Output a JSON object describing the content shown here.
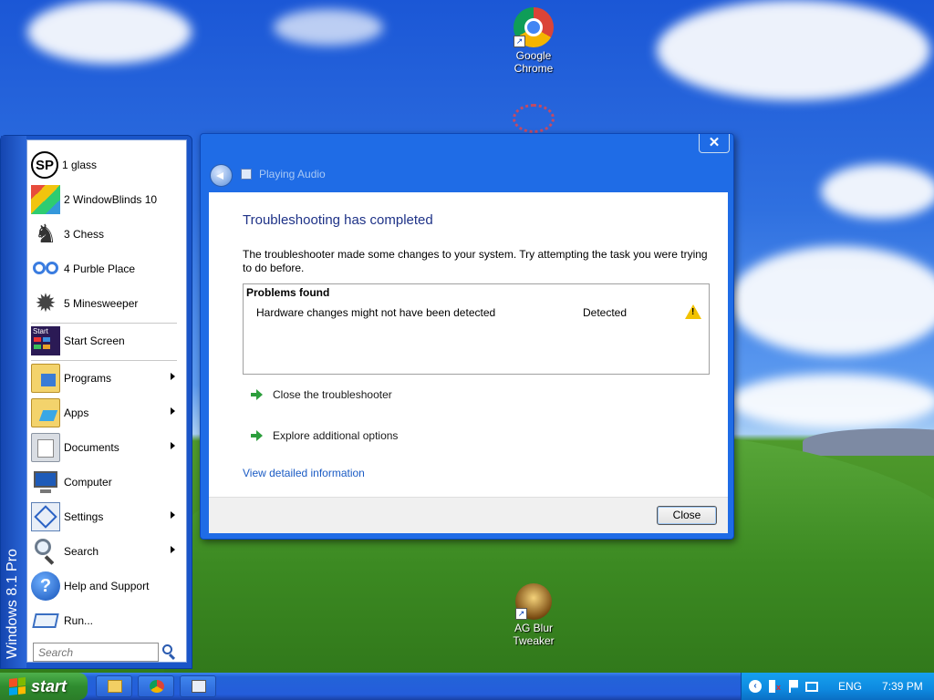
{
  "desktop": {
    "icons": [
      {
        "label": "Google Chrome",
        "icon": "chrome-icon"
      },
      {
        "label": "AG Blur Tweaker",
        "icon": "ag-blur-tweaker-icon"
      }
    ]
  },
  "start_menu": {
    "side_text": "Windows 8.1 Pro",
    "pinned": [
      {
        "label": "1 glass",
        "icon": "sp-icon"
      },
      {
        "label": "2 WindowBlinds 10",
        "icon": "windowblinds-icon"
      },
      {
        "label": "3 Chess",
        "icon": "chess-icon"
      },
      {
        "label": "4 Purble Place",
        "icon": "purble-place-icon"
      },
      {
        "label": "5 Minesweeper",
        "icon": "minesweeper-icon"
      }
    ],
    "start_screen": {
      "label": "Start Screen",
      "badge": "Start",
      "icon": "start-screen-icon"
    },
    "items": [
      {
        "label": "Programs",
        "icon": "programs-icon",
        "submenu": true
      },
      {
        "label": "Apps",
        "icon": "apps-icon",
        "submenu": true
      },
      {
        "label": "Documents",
        "icon": "documents-icon",
        "submenu": true
      },
      {
        "label": "Computer",
        "icon": "computer-icon",
        "submenu": false
      },
      {
        "label": "Settings",
        "icon": "settings-icon",
        "submenu": true
      },
      {
        "label": "Search",
        "icon": "search-icon",
        "submenu": true
      },
      {
        "label": "Help and Support",
        "icon": "help-icon",
        "submenu": false
      },
      {
        "label": "Run...",
        "icon": "run-icon",
        "submenu": false
      }
    ],
    "search_placeholder": "Search"
  },
  "dialog": {
    "title": "Playing Audio",
    "close_glyph": "✕",
    "heading": "Troubleshooting has completed",
    "description": "The troubleshooter made some changes to your system. Try attempting the task you were trying to do before.",
    "problems_header": "Problems found",
    "problems": [
      {
        "text": "Hardware changes might not have been detected",
        "status": "Detected",
        "icon": "warning-icon"
      }
    ],
    "actions": [
      {
        "label": "Close the troubleshooter"
      },
      {
        "label": "Explore additional options"
      }
    ],
    "details_link": "View detailed information",
    "close_button": "Close"
  },
  "taskbar": {
    "start_label": "start",
    "buttons": [
      {
        "icon": "file-explorer-icon"
      },
      {
        "icon": "chrome-icon"
      },
      {
        "icon": "troubleshooter-window-icon"
      }
    ],
    "tray": {
      "language": "ENG",
      "time": "7:39 PM",
      "icons": [
        "show-hidden-icons-icon",
        "speaker-muted-icon",
        "action-center-flag-icon",
        "network-icon"
      ]
    }
  },
  "colors": {
    "dialog_frame": "#1f6ce6",
    "start_menu": "#1a55c8",
    "start_button": "#2f8c2f",
    "link": "#1a5bc4",
    "heading": "#1e3287"
  }
}
